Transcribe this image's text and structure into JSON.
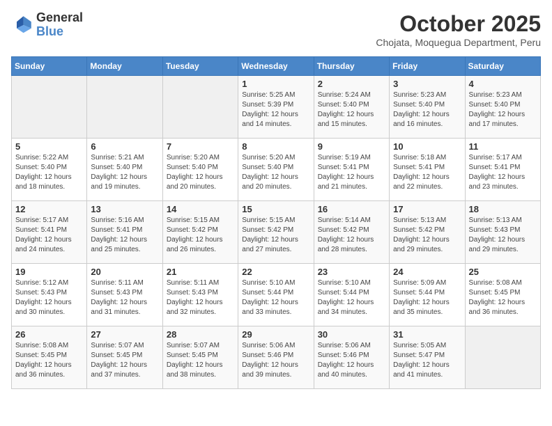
{
  "header": {
    "logo_line1": "General",
    "logo_line2": "Blue",
    "month": "October 2025",
    "location": "Chojata, Moquegua Department, Peru"
  },
  "weekdays": [
    "Sunday",
    "Monday",
    "Tuesday",
    "Wednesday",
    "Thursday",
    "Friday",
    "Saturday"
  ],
  "weeks": [
    [
      {
        "day": "",
        "info": ""
      },
      {
        "day": "",
        "info": ""
      },
      {
        "day": "",
        "info": ""
      },
      {
        "day": "1",
        "info": "Sunrise: 5:25 AM\nSunset: 5:39 PM\nDaylight: 12 hours\nand 14 minutes."
      },
      {
        "day": "2",
        "info": "Sunrise: 5:24 AM\nSunset: 5:40 PM\nDaylight: 12 hours\nand 15 minutes."
      },
      {
        "day": "3",
        "info": "Sunrise: 5:23 AM\nSunset: 5:40 PM\nDaylight: 12 hours\nand 16 minutes."
      },
      {
        "day": "4",
        "info": "Sunrise: 5:23 AM\nSunset: 5:40 PM\nDaylight: 12 hours\nand 17 minutes."
      }
    ],
    [
      {
        "day": "5",
        "info": "Sunrise: 5:22 AM\nSunset: 5:40 PM\nDaylight: 12 hours\nand 18 minutes."
      },
      {
        "day": "6",
        "info": "Sunrise: 5:21 AM\nSunset: 5:40 PM\nDaylight: 12 hours\nand 19 minutes."
      },
      {
        "day": "7",
        "info": "Sunrise: 5:20 AM\nSunset: 5:40 PM\nDaylight: 12 hours\nand 20 minutes."
      },
      {
        "day": "8",
        "info": "Sunrise: 5:20 AM\nSunset: 5:40 PM\nDaylight: 12 hours\nand 20 minutes."
      },
      {
        "day": "9",
        "info": "Sunrise: 5:19 AM\nSunset: 5:41 PM\nDaylight: 12 hours\nand 21 minutes."
      },
      {
        "day": "10",
        "info": "Sunrise: 5:18 AM\nSunset: 5:41 PM\nDaylight: 12 hours\nand 22 minutes."
      },
      {
        "day": "11",
        "info": "Sunrise: 5:17 AM\nSunset: 5:41 PM\nDaylight: 12 hours\nand 23 minutes."
      }
    ],
    [
      {
        "day": "12",
        "info": "Sunrise: 5:17 AM\nSunset: 5:41 PM\nDaylight: 12 hours\nand 24 minutes."
      },
      {
        "day": "13",
        "info": "Sunrise: 5:16 AM\nSunset: 5:41 PM\nDaylight: 12 hours\nand 25 minutes."
      },
      {
        "day": "14",
        "info": "Sunrise: 5:15 AM\nSunset: 5:42 PM\nDaylight: 12 hours\nand 26 minutes."
      },
      {
        "day": "15",
        "info": "Sunrise: 5:15 AM\nSunset: 5:42 PM\nDaylight: 12 hours\nand 27 minutes."
      },
      {
        "day": "16",
        "info": "Sunrise: 5:14 AM\nSunset: 5:42 PM\nDaylight: 12 hours\nand 28 minutes."
      },
      {
        "day": "17",
        "info": "Sunrise: 5:13 AM\nSunset: 5:42 PM\nDaylight: 12 hours\nand 29 minutes."
      },
      {
        "day": "18",
        "info": "Sunrise: 5:13 AM\nSunset: 5:43 PM\nDaylight: 12 hours\nand 29 minutes."
      }
    ],
    [
      {
        "day": "19",
        "info": "Sunrise: 5:12 AM\nSunset: 5:43 PM\nDaylight: 12 hours\nand 30 minutes."
      },
      {
        "day": "20",
        "info": "Sunrise: 5:11 AM\nSunset: 5:43 PM\nDaylight: 12 hours\nand 31 minutes."
      },
      {
        "day": "21",
        "info": "Sunrise: 5:11 AM\nSunset: 5:43 PM\nDaylight: 12 hours\nand 32 minutes."
      },
      {
        "day": "22",
        "info": "Sunrise: 5:10 AM\nSunset: 5:44 PM\nDaylight: 12 hours\nand 33 minutes."
      },
      {
        "day": "23",
        "info": "Sunrise: 5:10 AM\nSunset: 5:44 PM\nDaylight: 12 hours\nand 34 minutes."
      },
      {
        "day": "24",
        "info": "Sunrise: 5:09 AM\nSunset: 5:44 PM\nDaylight: 12 hours\nand 35 minutes."
      },
      {
        "day": "25",
        "info": "Sunrise: 5:08 AM\nSunset: 5:45 PM\nDaylight: 12 hours\nand 36 minutes."
      }
    ],
    [
      {
        "day": "26",
        "info": "Sunrise: 5:08 AM\nSunset: 5:45 PM\nDaylight: 12 hours\nand 36 minutes."
      },
      {
        "day": "27",
        "info": "Sunrise: 5:07 AM\nSunset: 5:45 PM\nDaylight: 12 hours\nand 37 minutes."
      },
      {
        "day": "28",
        "info": "Sunrise: 5:07 AM\nSunset: 5:45 PM\nDaylight: 12 hours\nand 38 minutes."
      },
      {
        "day": "29",
        "info": "Sunrise: 5:06 AM\nSunset: 5:46 PM\nDaylight: 12 hours\nand 39 minutes."
      },
      {
        "day": "30",
        "info": "Sunrise: 5:06 AM\nSunset: 5:46 PM\nDaylight: 12 hours\nand 40 minutes."
      },
      {
        "day": "31",
        "info": "Sunrise: 5:05 AM\nSunset: 5:47 PM\nDaylight: 12 hours\nand 41 minutes."
      },
      {
        "day": "",
        "info": ""
      }
    ]
  ]
}
